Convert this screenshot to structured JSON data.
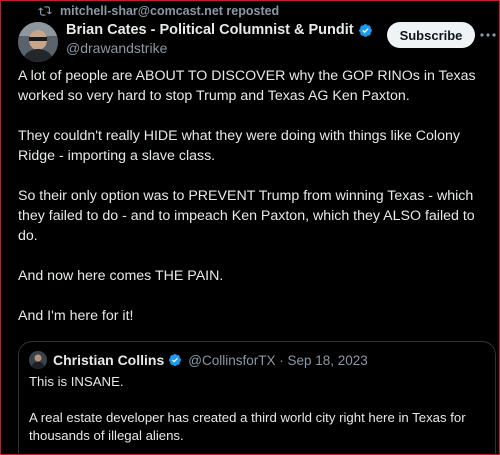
{
  "repost": {
    "text": "mitchell-shar@comcast.net reposted"
  },
  "author": {
    "name": "Brian Cates - Political Columnist & Pundit",
    "handle": "@drawandstrike"
  },
  "actions": {
    "subscribe_label": "Subscribe"
  },
  "tweet": {
    "paragraphs": [
      "A lot of people are ABOUT TO DISCOVER why the GOP RINOs in Texas worked so very hard to stop Trump and Texas AG Ken Paxton.",
      "They couldn't really HIDE what they were doing with things like Colony Ridge - importing a slave class.",
      "So their only option was to PREVENT Trump from winning Texas - which they failed to do - and to impeach Ken Paxton, which they ALSO failed to do.",
      "And now here comes THE PAIN.",
      "And I'm here for it!"
    ]
  },
  "quote": {
    "name": "Christian Collins",
    "meta": "@CollinsforTX · Sep 18, 2023",
    "paragraphs": [
      "This is INSANE.",
      "A real estate developer has created a third world city right here in Texas for thousands of illegal aliens."
    ]
  },
  "colors": {
    "background": "#000000",
    "text": "#e7e9ea",
    "secondary": "#8b98a5",
    "verified": "#1d9bf0",
    "border": "#2f3336"
  },
  "icons": {
    "repost": "repost-icon",
    "verified": "verified-badge-icon",
    "more": "more-icon"
  }
}
